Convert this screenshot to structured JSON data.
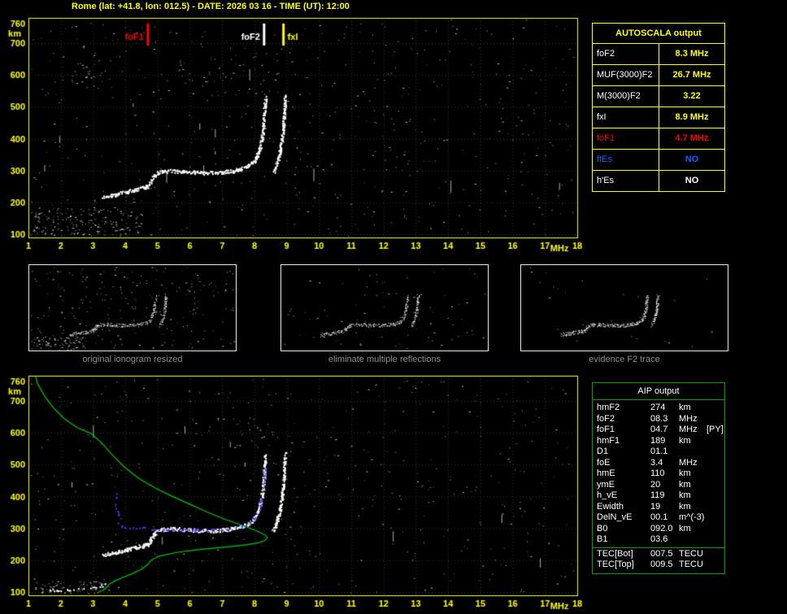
{
  "header": {
    "title": "Rome (lat: +41.8, lon: 012.5) - DATE: 2026 03 16 - TIME (UT): 12:00"
  },
  "colors": {
    "background": "#000000",
    "axis": "#ffff00",
    "grid": "#3c3c3c",
    "trace_white": "#ffffff",
    "profile_green": "#00cc00",
    "restored_blue": "#3a3aff",
    "fof1_red": "#ff0000",
    "ftes_blue": "#0066ff",
    "caption_gray": "#8f8f8f",
    "aip_border_green": "#00a000"
  },
  "autoscala": {
    "title": "AUTOSCALA output",
    "rows": [
      {
        "param": "foF2",
        "value": "8.3 MHz",
        "param_color": "#ffffff",
        "value_color": "#ffff00"
      },
      {
        "param": "MUF(3000)F2",
        "value": "26.7 MHz",
        "param_color": "#ffffff",
        "value_color": "#ffff00"
      },
      {
        "param": "M(3000)F2",
        "value": "3.22",
        "param_color": "#ffffff",
        "value_color": "#ffff00"
      },
      {
        "param": "fxI",
        "value": "8.9 MHz",
        "param_color": "#ffffff",
        "value_color": "#ffff00"
      },
      {
        "param": "foF1",
        "value": "4.7 MHz",
        "param_color": "#ff0000",
        "value_color": "#ff0000"
      },
      {
        "param": "ftEs",
        "value": "NO",
        "param_color": "#0066ff",
        "value_color": "#0066ff"
      },
      {
        "param": "h'Es",
        "value": "NO",
        "param_color": "#ffffff",
        "value_color": "#ffffff"
      }
    ]
  },
  "thumbnails": [
    {
      "caption": "original ionogram resized"
    },
    {
      "caption": "eliminate multiple reflections"
    },
    {
      "caption": "evidence F2 trace"
    }
  ],
  "aip": {
    "title": "AIP output",
    "rows": [
      {
        "param": "hmF2",
        "value": "274",
        "unit": "km",
        "note": ""
      },
      {
        "param": "foF2",
        "value": "08.3",
        "unit": "MHz",
        "note": ""
      },
      {
        "param": "foF1",
        "value": "04.7",
        "unit": "MHz",
        "note": "[PY]"
      },
      {
        "param": "hmF1",
        "value": "189",
        "unit": "km",
        "note": ""
      },
      {
        "param": "D1",
        "value": "01.1",
        "unit": "",
        "note": ""
      },
      {
        "param": "foE",
        "value": "3.4",
        "unit": "MHz",
        "note": ""
      },
      {
        "param": "hmE",
        "value": "110",
        "unit": "km",
        "note": ""
      },
      {
        "param": "ymE",
        "value": "20",
        "unit": "km",
        "note": ""
      },
      {
        "param": "h_vE",
        "value": "119",
        "unit": "km",
        "note": ""
      },
      {
        "param": "Ewidth",
        "value": "19",
        "unit": "km",
        "note": ""
      },
      {
        "param": "DelN_vE",
        "value": "00.1",
        "unit": "m^(-3)",
        "note": ""
      },
      {
        "param": "B0",
        "value": "092.0",
        "unit": "km",
        "note": ""
      },
      {
        "param": "B1",
        "value": "03.6",
        "unit": "",
        "note": ""
      },
      {
        "param": "TEC[Bot]",
        "value": "007.5",
        "unit": "TECU",
        "note": ""
      },
      {
        "param": "TEC[Top]",
        "value": "009.5",
        "unit": "TECU",
        "note": ""
      }
    ]
  },
  "chart_data": [
    {
      "id": "ionogram-main",
      "type": "scatter",
      "title": "",
      "xlabel": "MHz",
      "ylabel": "km",
      "xlim": [
        1,
        18
      ],
      "ylim": [
        90,
        779
      ],
      "xticks": [
        1,
        2,
        3,
        4,
        5,
        6,
        7,
        8,
        9,
        10,
        11,
        12,
        13,
        14,
        15,
        16,
        17,
        18
      ],
      "yticks": [
        100,
        200,
        300,
        400,
        500,
        600,
        700,
        760
      ],
      "grid": true,
      "annotations": [
        {
          "label": "foF1",
          "x": 4.7,
          "color": "#ff0000",
          "side": "left"
        },
        {
          "label": "foF2",
          "x": 8.3,
          "color": "#ffffff",
          "side": "left"
        },
        {
          "label": "fxI",
          "x": 8.9,
          "color": "#ffff00",
          "side": "right"
        }
      ],
      "series": [
        {
          "name": "O-mode-trace",
          "color": "#ffffff",
          "style": "speckle",
          "points": [
            [
              3.3,
              217
            ],
            [
              3.55,
              223
            ],
            [
              3.8,
              229
            ],
            [
              4.05,
              235
            ],
            [
              4.3,
              241
            ],
            [
              4.55,
              247
            ],
            [
              4.68,
              252
            ],
            [
              4.78,
              266
            ],
            [
              4.88,
              284
            ],
            [
              5.0,
              295
            ],
            [
              5.2,
              299
            ],
            [
              5.5,
              300
            ],
            [
              5.8,
              298
            ],
            [
              6.1,
              295
            ],
            [
              6.4,
              294
            ],
            [
              6.7,
              294
            ],
            [
              7.0,
              296
            ],
            [
              7.3,
              300
            ],
            [
              7.55,
              306
            ],
            [
              7.8,
              316
            ],
            [
              7.98,
              331
            ],
            [
              8.08,
              350
            ],
            [
              8.16,
              375
            ],
            [
              8.22,
              405
            ],
            [
              8.26,
              440
            ],
            [
              8.29,
              475
            ],
            [
              8.31,
              505
            ],
            [
              8.33,
              530
            ]
          ]
        },
        {
          "name": "X-mode-trace",
          "color": "#ffffff",
          "style": "speckle",
          "points": [
            [
              8.58,
              295
            ],
            [
              8.66,
              315
            ],
            [
              8.73,
              338
            ],
            [
              8.79,
              365
            ],
            [
              8.84,
              398
            ],
            [
              8.88,
              432
            ],
            [
              8.9,
              468
            ],
            [
              8.92,
              505
            ],
            [
              8.94,
              538
            ]
          ]
        }
      ]
    },
    {
      "id": "ionogram-aip",
      "type": "scatter",
      "title": "",
      "xlabel": "MHz",
      "ylabel": "km",
      "xlim": [
        1,
        18
      ],
      "ylim": [
        90,
        779
      ],
      "xticks": [
        1,
        2,
        3,
        4,
        5,
        6,
        7,
        8,
        9,
        10,
        11,
        12,
        13,
        14,
        15,
        16,
        17,
        18
      ],
      "yticks": [
        100,
        200,
        300,
        400,
        500,
        600,
        700,
        760
      ],
      "grid": true,
      "series": [
        {
          "name": "electron-density-profile",
          "color": "#00cc00",
          "style": "line",
          "points": [
            [
              1.22,
              778
            ],
            [
              1.28,
              755
            ],
            [
              1.5,
              715
            ],
            [
              1.78,
              678
            ],
            [
              2.1,
              645
            ],
            [
              2.5,
              617
            ],
            [
              2.95,
              597
            ],
            [
              3.3,
              565
            ],
            [
              3.62,
              528
            ],
            [
              3.98,
              492
            ],
            [
              4.4,
              458
            ],
            [
              4.9,
              428
            ],
            [
              5.4,
              403
            ],
            [
              5.95,
              378
            ],
            [
              6.5,
              353
            ],
            [
              7.1,
              328
            ],
            [
              7.7,
              307
            ],
            [
              8.1,
              291
            ],
            [
              8.33,
              279
            ],
            [
              8.4,
              272
            ],
            [
              8.33,
              262
            ],
            [
              8.05,
              253
            ],
            [
              7.55,
              246
            ],
            [
              6.85,
              239
            ],
            [
              6.15,
              232
            ],
            [
              5.55,
              224
            ],
            [
              5.05,
              213
            ],
            [
              4.82,
              201
            ],
            [
              4.73,
              192
            ],
            [
              4.7,
              187
            ],
            [
              4.52,
              173
            ],
            [
              4.22,
              158
            ],
            [
              3.92,
              146
            ],
            [
              3.68,
              135
            ],
            [
              3.52,
              126
            ],
            [
              3.44,
              118
            ],
            [
              3.4,
              112
            ],
            [
              3.33,
              107
            ],
            [
              3.22,
              102
            ],
            [
              3.12,
              97
            ]
          ]
        },
        {
          "name": "O-mode-trace",
          "color": "#ffffff",
          "style": "speckle",
          "points": [
            [
              3.3,
              217
            ],
            [
              3.55,
              223
            ],
            [
              3.8,
              229
            ],
            [
              4.05,
              235
            ],
            [
              4.3,
              241
            ],
            [
              4.55,
              247
            ],
            [
              4.68,
              252
            ],
            [
              4.78,
              266
            ],
            [
              4.88,
              284
            ],
            [
              5.0,
              295
            ],
            [
              5.2,
              299
            ],
            [
              5.5,
              300
            ],
            [
              5.8,
              298
            ],
            [
              6.1,
              295
            ],
            [
              6.4,
              294
            ],
            [
              6.7,
              294
            ],
            [
              7.0,
              296
            ],
            [
              7.3,
              300
            ],
            [
              7.55,
              306
            ],
            [
              7.8,
              316
            ],
            [
              7.98,
              331
            ],
            [
              8.08,
              350
            ],
            [
              8.16,
              375
            ],
            [
              8.22,
              405
            ],
            [
              8.26,
              440
            ],
            [
              8.29,
              475
            ],
            [
              8.31,
              505
            ],
            [
              8.33,
              530
            ]
          ]
        },
        {
          "name": "X-mode-trace",
          "color": "#ffffff",
          "style": "speckle",
          "points": [
            [
              8.58,
              295
            ],
            [
              8.66,
              315
            ],
            [
              8.73,
              338
            ],
            [
              8.79,
              365
            ],
            [
              8.84,
              398
            ],
            [
              8.88,
              432
            ],
            [
              8.9,
              468
            ],
            [
              8.92,
              505
            ],
            [
              8.94,
              538
            ]
          ]
        },
        {
          "name": "E-region-trace",
          "color": "#ffffff",
          "style": "speckle",
          "sparse": true,
          "points": [
            [
              1.55,
              106
            ],
            [
              1.9,
              108
            ],
            [
              2.3,
              110
            ],
            [
              2.7,
              113
            ],
            [
              3.0,
              117
            ],
            [
              3.25,
              122
            ],
            [
              3.38,
              128
            ]
          ]
        },
        {
          "name": "restored-true-trace",
          "color": "#3a3aff",
          "style": "speckle",
          "sparse": true,
          "points": [
            [
              3.68,
              412
            ],
            [
              3.71,
              380
            ],
            [
              3.74,
              350
            ],
            [
              3.79,
              322
            ],
            [
              3.9,
              306
            ],
            [
              4.15,
              302
            ],
            [
              4.5,
              302
            ],
            [
              4.9,
              299
            ],
            [
              5.3,
              298
            ],
            [
              5.7,
              297
            ],
            [
              6.1,
              295
            ],
            [
              6.5,
              295
            ],
            [
              6.9,
              297
            ],
            [
              7.25,
              301
            ],
            [
              7.6,
              308
            ],
            [
              7.85,
              320
            ],
            [
              8.02,
              338
            ],
            [
              8.12,
              360
            ],
            [
              8.2,
              392
            ],
            [
              8.25,
              428
            ],
            [
              8.28,
              462
            ],
            [
              8.31,
              495
            ]
          ]
        }
      ]
    }
  ]
}
